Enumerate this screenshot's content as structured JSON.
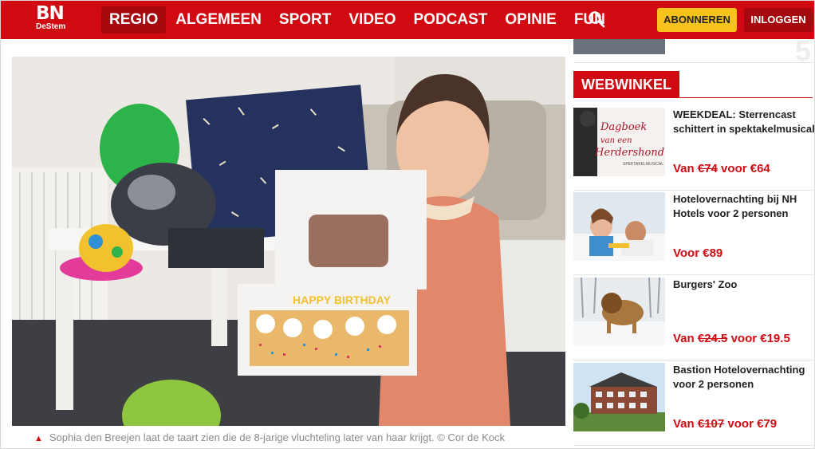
{
  "header": {
    "logo_main": "BN",
    "logo_sub": "DeStem",
    "nav": [
      {
        "label": "REGIO",
        "active": true
      },
      {
        "label": "ALGEMEEN",
        "active": false
      },
      {
        "label": "SPORT",
        "active": false
      },
      {
        "label": "VIDEO",
        "active": false
      },
      {
        "label": "PODCAST",
        "active": false
      },
      {
        "label": "OPINIE",
        "active": false
      },
      {
        "label": "FUN",
        "active": false
      }
    ],
    "subscribe_label": "ABONNEREN",
    "login_label": "INLOGGEN"
  },
  "hero": {
    "caption": "Sophia den Breejen laat de taart zien die de 8-jarige vluchteling later van haar krijgt. © Cor de Kock",
    "cake_text": "HAPPY BIRTHDAY"
  },
  "sidebar": {
    "rank_number": "5",
    "section_title": "WEBWINKEL",
    "thumb_text": "Dagboek van een Herdershond",
    "thumb_subtext": "SPEKTAKELMUSICAL",
    "items": [
      {
        "title": "WEEKDEAL: Sterrencast schittert in spektakelmusical",
        "price_prefix": "Van ",
        "old_price": "€74",
        "price_mid": " voor ",
        "new_price": "€64"
      },
      {
        "title": "Hotelovernachting bij NH Hotels voor 2 personen",
        "price_prefix": "Voor ",
        "old_price": "",
        "price_mid": "",
        "new_price": "€89"
      },
      {
        "title": "Burgers' Zoo",
        "price_prefix": "Van ",
        "old_price": "€24.5",
        "price_mid": " voor ",
        "new_price": "€19.5"
      },
      {
        "title": "Bastion Hotelovernachting voor 2 personen",
        "price_prefix": "Van ",
        "old_price": "€107",
        "price_mid": " voor ",
        "new_price": "€79"
      }
    ]
  },
  "colors": {
    "brand_red": "#d10a11",
    "subscribe_yellow": "#f7c21a",
    "price_red": "#d10a11"
  },
  "icons": [
    "search-icon",
    "caption-triangle-icon"
  ]
}
